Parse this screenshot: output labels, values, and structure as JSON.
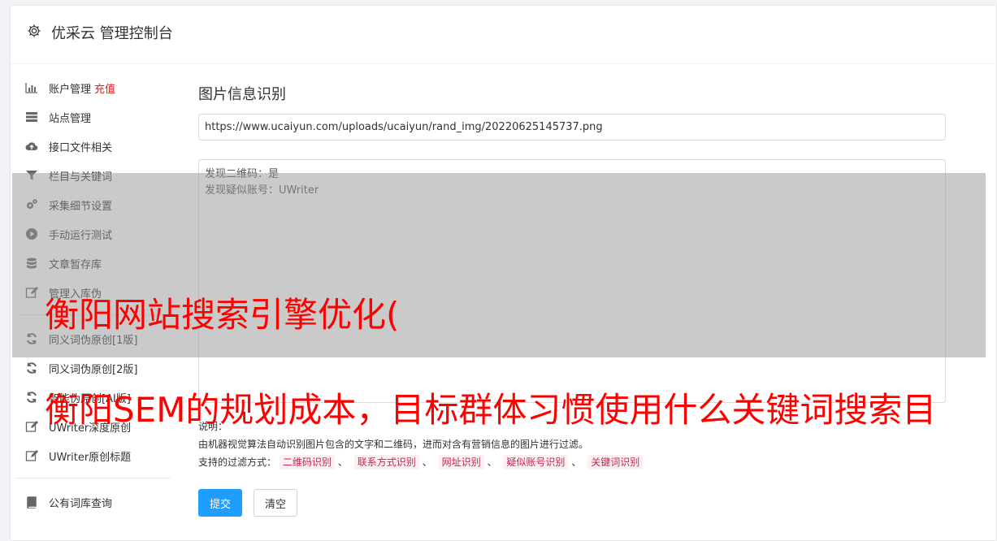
{
  "header": {
    "title": "优采云 管理控制台"
  },
  "sidebar": {
    "items": [
      {
        "label": "账户管理",
        "extra": "充值",
        "icon": "bar-chart-icon"
      },
      {
        "label": "站点管理",
        "icon": "server-icon"
      },
      {
        "label": "接口文件相关",
        "icon": "cloud-upload-icon"
      },
      {
        "label": "栏目与关键词",
        "icon": "filter-icon"
      },
      {
        "label": "采集细节设置",
        "icon": "gears-icon"
      },
      {
        "label": "手动运行测试",
        "icon": "play-circle-icon"
      },
      {
        "label": "文章暂存库",
        "icon": "database-icon"
      },
      {
        "label": "管理入库伪",
        "icon": "edit-icon"
      }
    ],
    "items2": [
      {
        "label": "同义词伪原创[1版]",
        "icon": "refresh-icon"
      },
      {
        "label": "同义词伪原创[2版]",
        "icon": "refresh-icon"
      },
      {
        "label": "智能伪原创[AI版]",
        "icon": "refresh-icon"
      },
      {
        "label": "UWriter深度原创",
        "icon": "edit-icon"
      },
      {
        "label": "UWriter原创标题",
        "icon": "edit-icon"
      }
    ],
    "items3": [
      {
        "label": "公有词库查询",
        "icon": "book-icon"
      }
    ]
  },
  "main": {
    "title": "图片信息识别",
    "url_value": "https://www.ucaiyun.com/uploads/ucaiyun/rand_img/20220625145737.png",
    "result_lines": [
      "发现二维码：是",
      "发现疑似账号：UWriter"
    ],
    "note_label": "说明：",
    "note_text": "由机器视觉算法自动识别图片包含的文字和二维码，进而对含有营销信息的图片进行过滤。",
    "filter_label": "支持的过滤方式：",
    "filters": [
      "二维码识别",
      "联系方式识别",
      "网址识别",
      "疑似账号识别",
      "关键词识别"
    ],
    "filter_separator": "、",
    "submit_label": "提交",
    "clear_label": "清空"
  },
  "overlay": {
    "line1": "衡阳网站搜索引擎优化(",
    "line2": "衡阳SEM的规划成本，目标群体习惯使用什么关键词搜索目"
  },
  "colors": {
    "accent": "#1e9fff",
    "highlight": "#e02020",
    "tag_text": "#c7254e",
    "overlay_text": "#ff0000"
  }
}
